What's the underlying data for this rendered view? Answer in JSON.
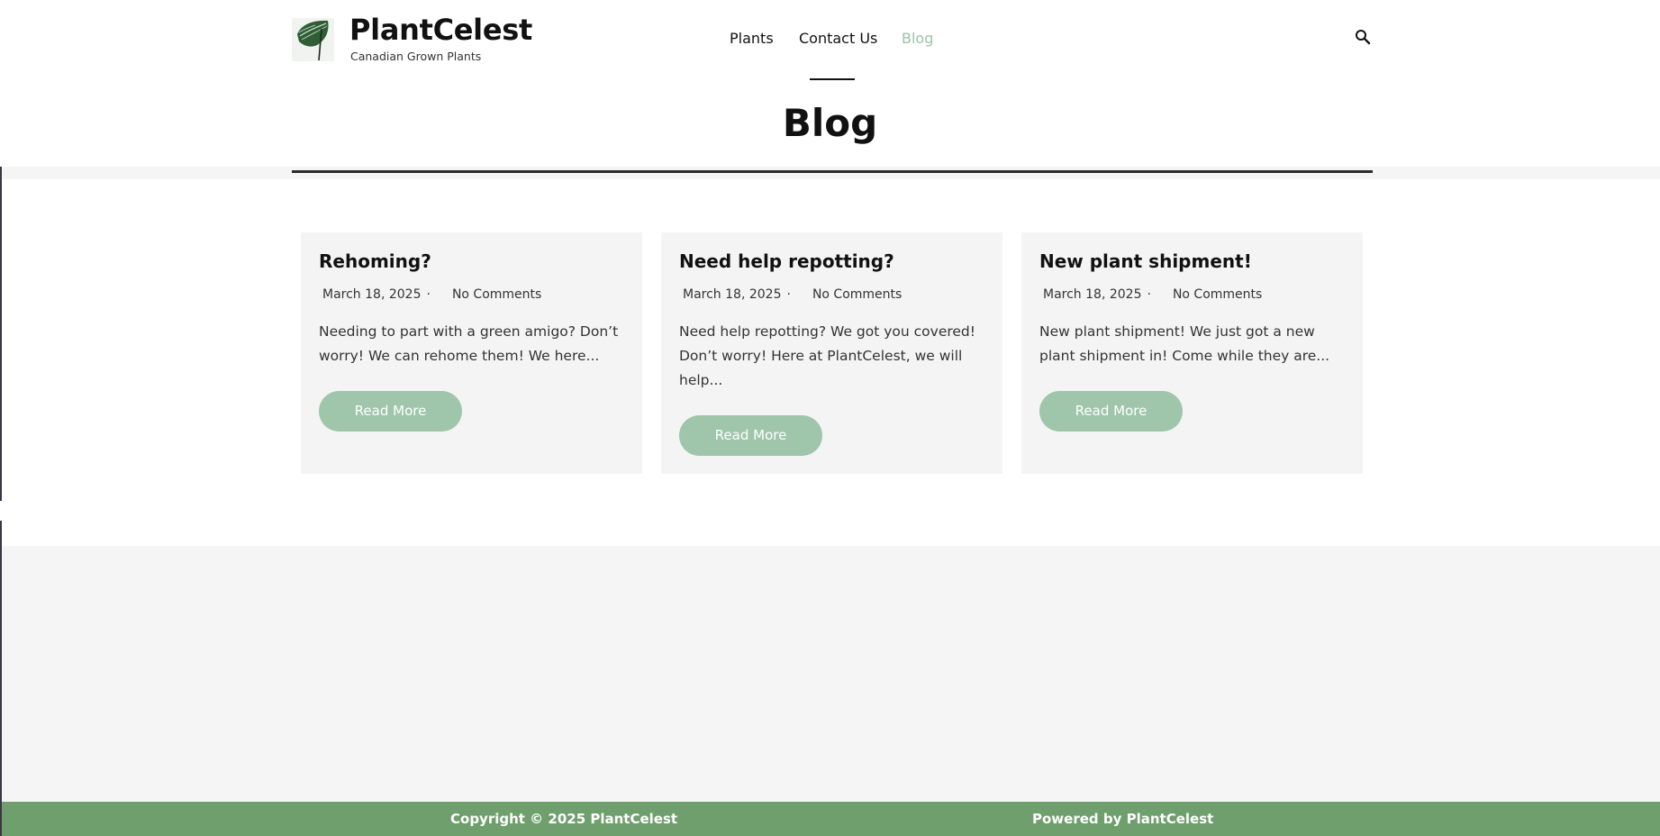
{
  "site": {
    "title": "PlantCelest",
    "tagline": "Canadian Grown Plants"
  },
  "nav": {
    "items": [
      {
        "label": "Plants",
        "active": false
      },
      {
        "label": "Contact Us",
        "active": false
      },
      {
        "label": "Blog",
        "active": true
      }
    ],
    "active_color": "#9bc3a8",
    "search_icon": "search-icon"
  },
  "page": {
    "title": "Blog"
  },
  "posts": [
    {
      "title": "Rehoming?",
      "date": "March 18, 2025",
      "separator": "·",
      "comments": "No Comments",
      "excerpt": "Needing to part with a green amigo? Don’t worry! We can rehome them! We here...",
      "button": "Read More"
    },
    {
      "title": "Need help repotting?",
      "date": "March 18, 2025",
      "separator": "·",
      "comments": "No Comments",
      "excerpt": "Need help repotting? We got you covered! Don’t worry! Here at PlantCelest, we will help...",
      "button": "Read More"
    },
    {
      "title": "New plant shipment!",
      "date": "March 18, 2025",
      "separator": "·",
      "comments": "No Comments",
      "excerpt": "New plant shipment! We just got a new plant shipment in! Come while they are...",
      "button": "Read More"
    }
  ],
  "footer": {
    "copyright": "Copyright © 2025 PlantCelest",
    "powered": "Powered by PlantCelest"
  },
  "colors": {
    "accent_green": "#9fc6ab",
    "footer_green": "#6e9f6d",
    "card_bg": "#f4f4f4"
  }
}
